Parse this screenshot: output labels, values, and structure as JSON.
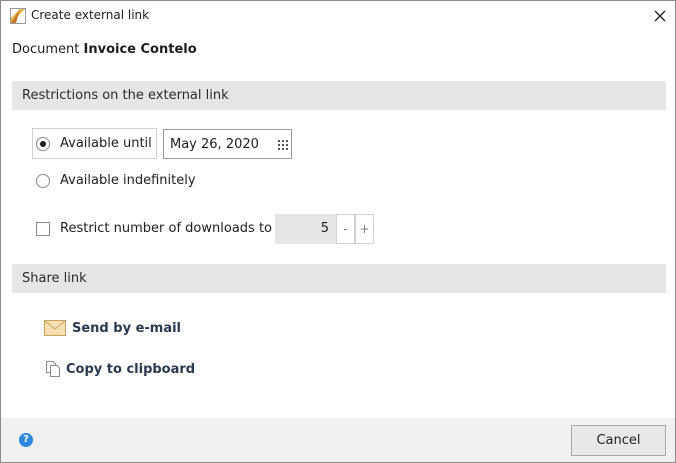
{
  "window": {
    "title": "Create external link",
    "close_icon": "close-icon",
    "app_icon": "document-icon"
  },
  "document": {
    "prefix": "Document",
    "name": "Invoice Contelo"
  },
  "restrictions": {
    "heading": "Restrictions on the external link",
    "available_until": {
      "label": "Available until",
      "selected": true,
      "date": "May 26, 2020"
    },
    "available_indefinitely": {
      "label": "Available indefinitely",
      "selected": false
    },
    "restrict_downloads": {
      "label": "Restrict number of downloads to",
      "checked": false,
      "value": "5",
      "minus": "-",
      "plus": "+"
    }
  },
  "share": {
    "heading": "Share link",
    "email": {
      "label": "Send by e-mail",
      "icon": "envelope-icon"
    },
    "clipboard": {
      "label": "Copy to clipboard",
      "icon": "copy-icon"
    }
  },
  "footer": {
    "help_icon": "?",
    "cancel_label": "Cancel"
  },
  "colors": {
    "section_bg": "#e6e6e6",
    "link_text": "#2b3a4f",
    "help_blue": "#2e86de",
    "footer_bg": "#f0f0f0"
  }
}
